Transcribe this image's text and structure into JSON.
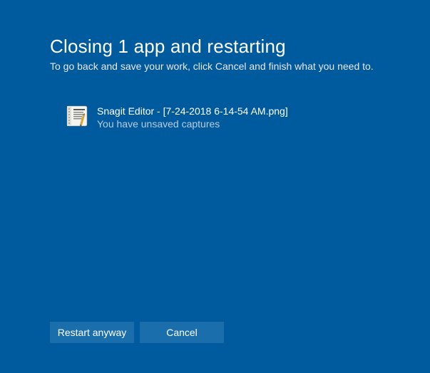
{
  "header": {
    "title": "Closing 1 app and restarting",
    "subtitle": "To go back and save your work, click Cancel and finish what you need to."
  },
  "apps": [
    {
      "icon_name": "snagit-editor-icon",
      "name": "Snagit Editor - [7-24-2018 6-14-54 AM.png]",
      "status": "You have unsaved captures"
    }
  ],
  "buttons": {
    "restart": "Restart anyway",
    "cancel": "Cancel"
  }
}
